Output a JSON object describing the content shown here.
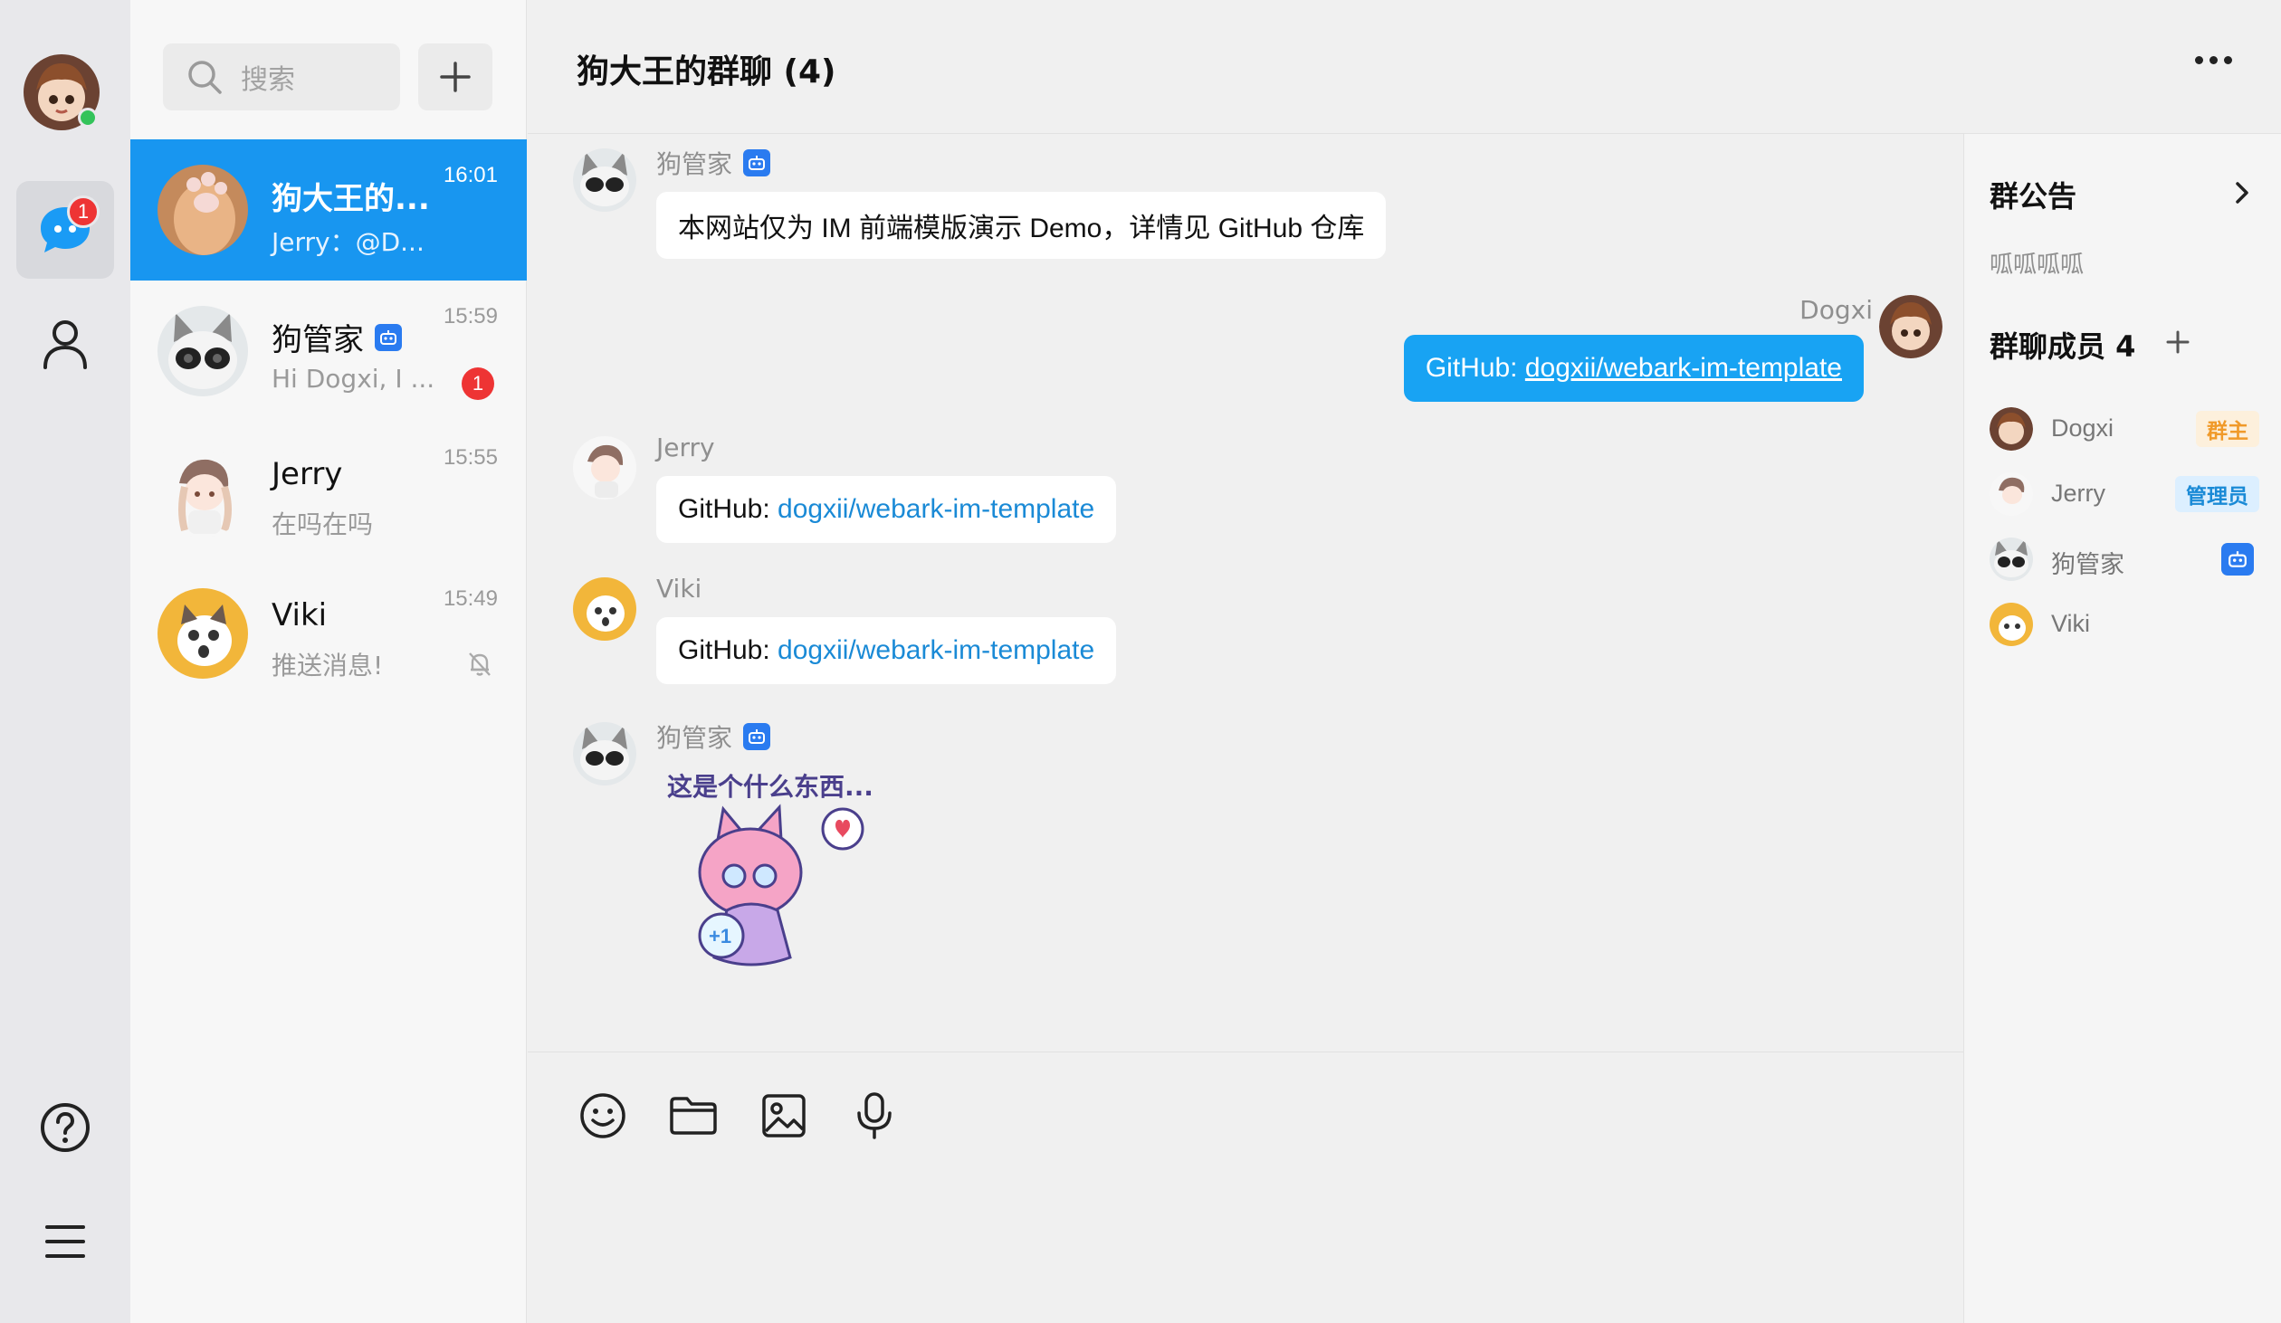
{
  "nav": {
    "badge_count": "1"
  },
  "search": {
    "placeholder": "搜索"
  },
  "conversations": [
    {
      "name": "狗大王的...",
      "preview": "Jerry：@D...",
      "time": "16:01"
    },
    {
      "name": "狗管家",
      "preview": "Hi Dogxi, I ...",
      "time": "15:59",
      "unread": "1"
    },
    {
      "name": "Jerry",
      "preview": "在吗在吗",
      "time": "15:55"
    },
    {
      "name": "Viki",
      "preview": "推送消息!",
      "time": "15:49"
    }
  ],
  "chat": {
    "title": "狗大王的群聊 (4)"
  },
  "messages": [
    {
      "sender": "狗管家",
      "text": "本网站仅为 IM 前端模版演示 Demo，详情见 GitHub 仓库"
    },
    {
      "sender": "Dogxi",
      "prefix": "GitHub: ",
      "link": "dogxii/webark-im-template"
    },
    {
      "sender": "Jerry",
      "prefix": "GitHub: ",
      "link": "dogxii/webark-im-template"
    },
    {
      "sender": "Viki",
      "prefix": "GitHub: ",
      "link": "dogxii/webark-im-template"
    },
    {
      "sender": "狗管家",
      "sticker_text": "这是个什么东西..."
    }
  ],
  "panel": {
    "notice_title": "群公告",
    "notice_text": "呱呱呱呱",
    "members_title": "群聊成员 4",
    "members": [
      {
        "name": "Dogxi",
        "role": "群主"
      },
      {
        "name": "Jerry",
        "role": "管理员"
      },
      {
        "name": "狗管家"
      },
      {
        "name": "Viki"
      }
    ]
  },
  "colors": {
    "accent": "#1896f0",
    "bubble_mine": "#18a3f3",
    "badge": "#ee3434",
    "online": "#33c35a",
    "link": "#1a8ad6"
  }
}
